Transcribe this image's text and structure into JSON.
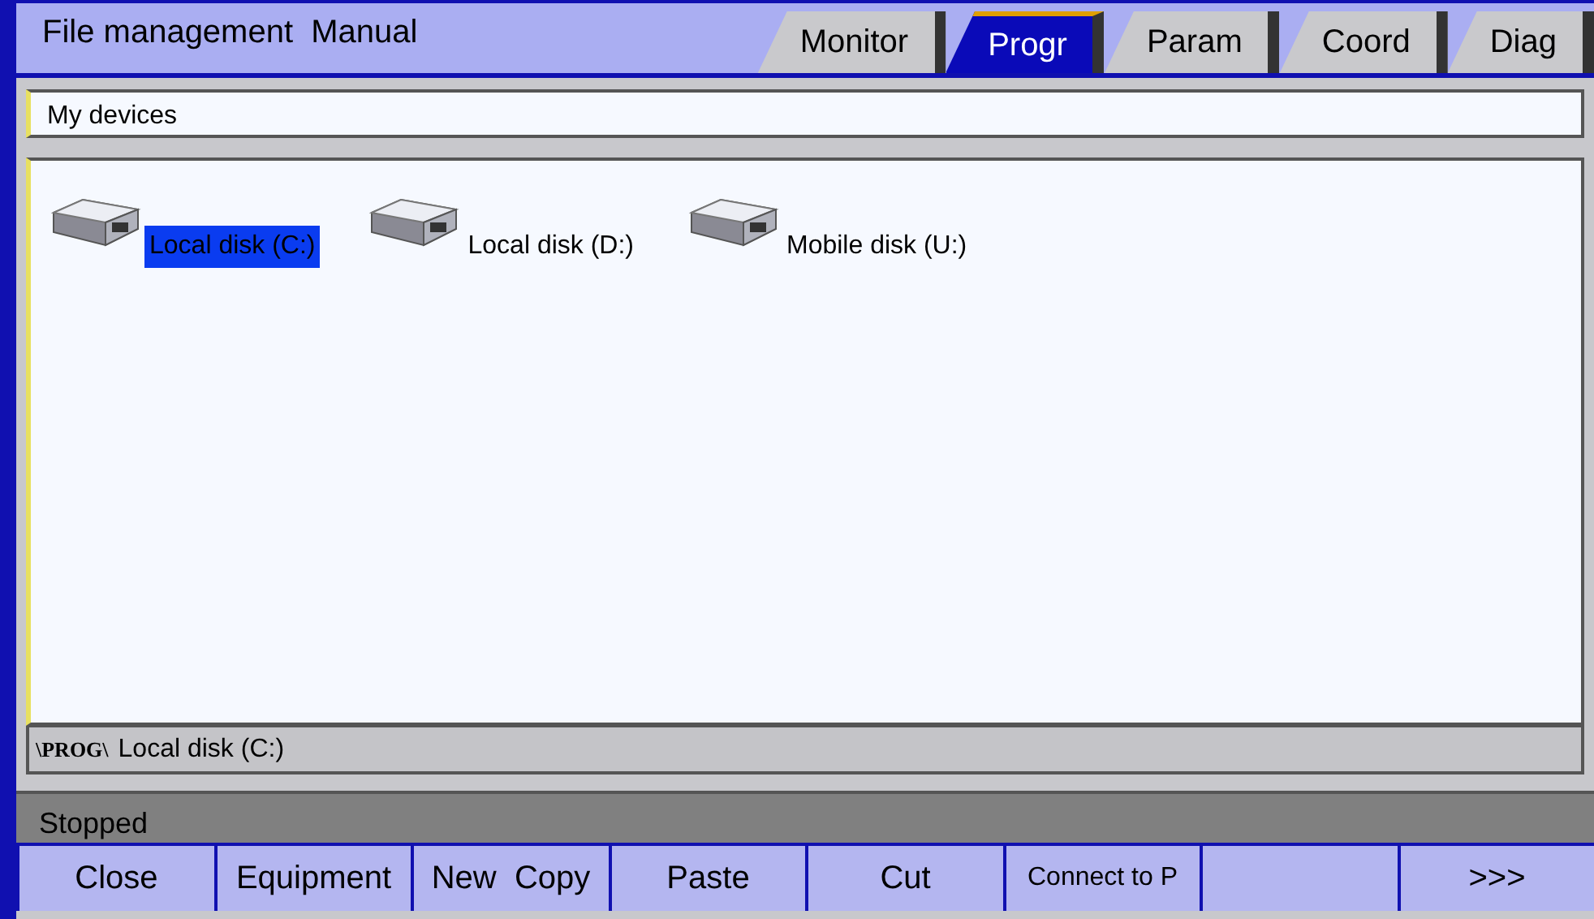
{
  "title_bar": {
    "title": "File management",
    "mode": "Manual"
  },
  "tabs": [
    {
      "label": "Monitor",
      "selected": false
    },
    {
      "label": "Progr",
      "selected": true
    },
    {
      "label": "Param",
      "selected": false
    },
    {
      "label": "Coord",
      "selected": false
    },
    {
      "label": "Diag",
      "selected": false
    }
  ],
  "address_bar": {
    "value": "My devices"
  },
  "devices": [
    {
      "label": "Local disk (C:)",
      "selected": true
    },
    {
      "label": "Local disk (D:)",
      "selected": false
    },
    {
      "label": "Mobile disk (U:)",
      "selected": false
    }
  ],
  "path_bar": {
    "tag": "\\PROG\\",
    "path": "Local disk (C:)"
  },
  "status_bar": {
    "text": "Stopped"
  },
  "softkeys": [
    {
      "kind": "label",
      "label": "Close"
    },
    {
      "kind": "label",
      "label": "Equipment"
    },
    {
      "kind": "label",
      "label": "New  Copy"
    },
    {
      "kind": "label",
      "label": "Paste"
    },
    {
      "kind": "label",
      "label": "Cut"
    },
    {
      "kind": "label",
      "label": "Connect to P"
    },
    {
      "kind": "blank"
    },
    {
      "kind": "label",
      "label": ">>>"
    }
  ]
}
